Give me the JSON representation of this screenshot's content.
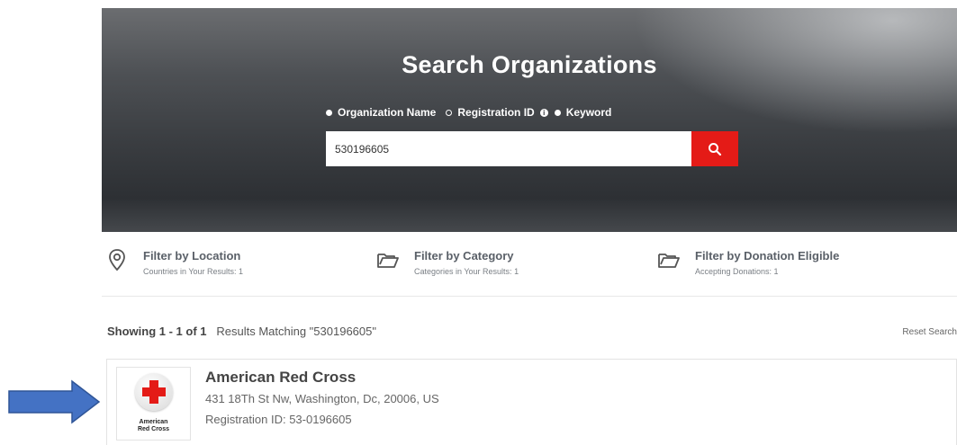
{
  "hero": {
    "title": "Search Organizations",
    "search_options": [
      {
        "label": "Organization Name",
        "selected": false
      },
      {
        "label": "Registration ID",
        "selected": true
      },
      {
        "label": "Keyword",
        "selected": false
      }
    ],
    "search_value": "530196605",
    "accent_color": "#e41b17"
  },
  "filters": [
    {
      "title": "Filter by Location",
      "subtitle": "Countries in Your Results: 1",
      "icon": "location-pin-icon"
    },
    {
      "title": "Filter by Category",
      "subtitle": "Categories in Your Results: 1",
      "icon": "folder-icon"
    },
    {
      "title": "Filter by Donation Eligible",
      "subtitle": "Accepting Donations: 1",
      "icon": "folder-icon"
    }
  ],
  "results": {
    "showing": "Showing 1 - 1 of 1",
    "matching": "Results Matching \"530196605\"",
    "reset": "Reset Search"
  },
  "organization": {
    "name": "American Red Cross",
    "address": "431 18Th St Nw, Washington, Dc, 20006, US",
    "registration": "Registration ID: 53-0196605",
    "logo_text_line1": "American",
    "logo_text_line2": "Red Cross"
  },
  "annotation": {
    "icon": "arrow-right-icon",
    "color": "#4472c4"
  }
}
